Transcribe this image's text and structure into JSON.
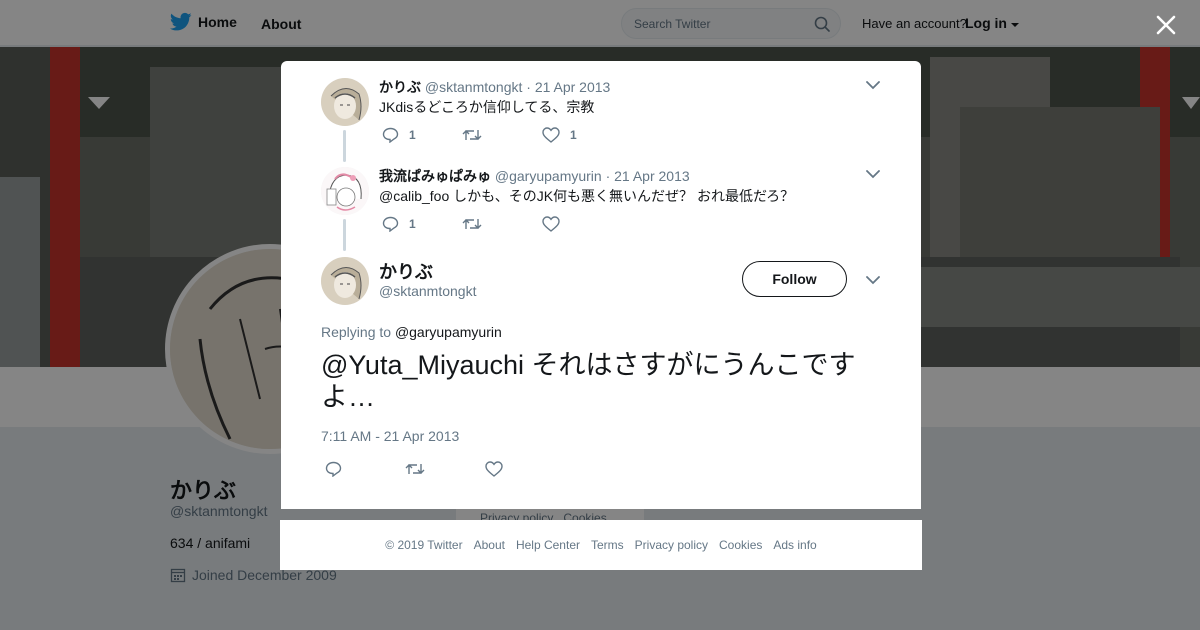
{
  "nav": {
    "home_label": "Home",
    "about_label": "About",
    "search_placeholder": "Search Twitter",
    "account_prompt": "Have an account?",
    "login_label": "Log in"
  },
  "profile": {
    "name": "かりぶ",
    "handle": "@sktanmtongkt",
    "bio": "634 / anifami",
    "joined": "Joined December 2009",
    "side_links": "Privacy policy   Cookies"
  },
  "thread": [
    {
      "name": "かりぶ",
      "handle": "@sktanmtongkt",
      "date": "· 21 Apr 2013",
      "text": "JKdisるどころか信仰してる、宗教",
      "reply_count": "1",
      "retweet_count": "",
      "like_count": "1"
    },
    {
      "name": "我流ぱみゅぱみゅ",
      "handle": "@garyupamyurin",
      "date": "· 21 Apr 2013",
      "text": "@calib_foo しかも、そのJK何も悪く無いんだぜ？ おれ最低だろ？",
      "reply_count": "1",
      "retweet_count": "",
      "like_count": ""
    }
  ],
  "main_tweet": {
    "name": "かりぶ",
    "handle": "@sktanmtongkt",
    "follow_label": "Follow",
    "replying_prefix": "Replying to",
    "replying_to": "@garyupamyurin",
    "text": "@Yuta_Miyauchi それはさすがにうんこですよ…",
    "timestamp": "7:11 AM - 21 Apr 2013"
  },
  "footer": {
    "copyright": "© 2019 Twitter",
    "links": [
      "About",
      "Help Center",
      "Terms",
      "Privacy policy",
      "Cookies",
      "Ads info"
    ]
  },
  "colors": {
    "twitter_blue": "#1da1f2",
    "text_primary": "#14171a",
    "text_secondary": "#657786",
    "overlay": "rgba(0,0,0,0.48)"
  }
}
